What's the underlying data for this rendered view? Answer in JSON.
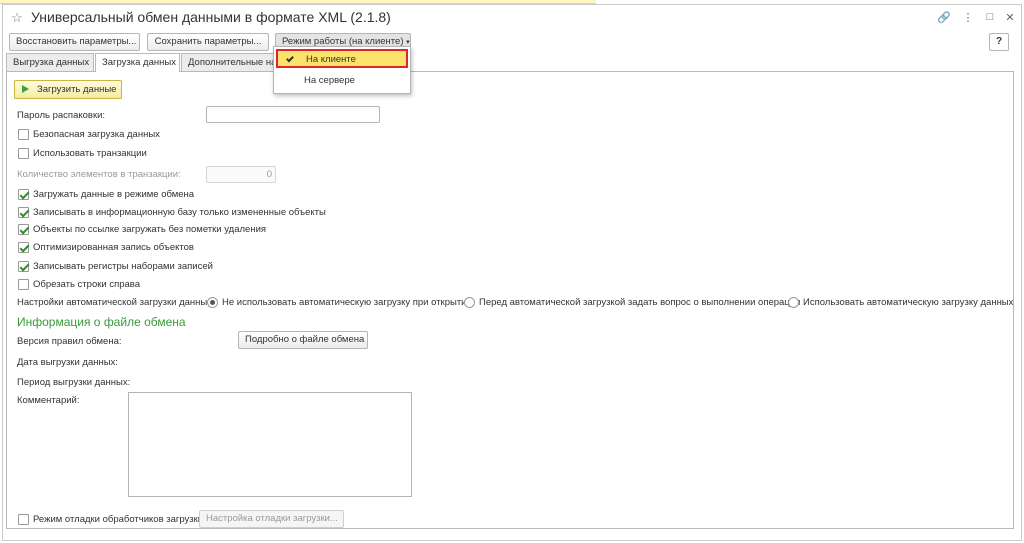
{
  "window": {
    "title": "Универсальный обмен данными в формате XML (2.1.8)"
  },
  "toolbar": {
    "restore_label": "Восстановить параметры...",
    "save_label": "Сохранить параметры...",
    "mode_label": "Режим работы (на клиенте)",
    "help_label": "?"
  },
  "tabs": [
    {
      "label": "Выгрузка данных"
    },
    {
      "label": "Загрузка данных"
    },
    {
      "label": "Дополнительные нас"
    }
  ],
  "mode_menu": {
    "items": [
      {
        "label": "На клиенте",
        "selected": true
      },
      {
        "label": "На сервере",
        "selected": false
      }
    ]
  },
  "load": {
    "load_button": "Загрузить данные",
    "password_label": "Пароль распаковки:",
    "password_value": "",
    "safe_load": {
      "label": "Безопасная загрузка данных",
      "checked": false
    },
    "use_transactions": {
      "label": "Использовать транзакции",
      "checked": false
    },
    "tx_count_label": "Количество элементов в транзакции:",
    "tx_count_value": "0",
    "exchange_mode": {
      "label": "Загружать данные в режиме обмена",
      "checked": true
    },
    "changed_only": {
      "label": "Записывать в информационную базу только измененные объекты",
      "checked": true
    },
    "ref_objects": {
      "label": "Объекты по ссылке загружать без пометки удаления",
      "checked": true
    },
    "optimized": {
      "label": "Оптимизированная запись объектов",
      "checked": true
    },
    "register_sets": {
      "label": "Записывать регистры наборами записей",
      "checked": true
    },
    "trim_right": {
      "label": "Обрезать строки справа",
      "checked": false
    },
    "auto_load_label": "Настройки автоматической загрузки данных:",
    "auto_load_options": [
      {
        "label": "Не использовать автоматическую загрузку при открытии",
        "selected": true
      },
      {
        "label": "Перед автоматической загрузкой задать вопрос о выполнении операции",
        "selected": false
      },
      {
        "label": "Использовать автоматическую загрузку данных",
        "selected": false
      }
    ]
  },
  "info": {
    "section_title": "Информация о файле обмена",
    "rules_version_label": "Версия правил обмена:",
    "details_button": "Подробно о файле обмена",
    "export_date_label": "Дата выгрузки данных:",
    "export_period_label": "Период выгрузки данных:",
    "comment_label": "Комментарий:",
    "comment_value": ""
  },
  "debug": {
    "debug_mode": {
      "label": "Режим отладки обработчиков загрузки",
      "checked": false
    },
    "debug_settings_button": "Настройка отладки загрузки..."
  }
}
